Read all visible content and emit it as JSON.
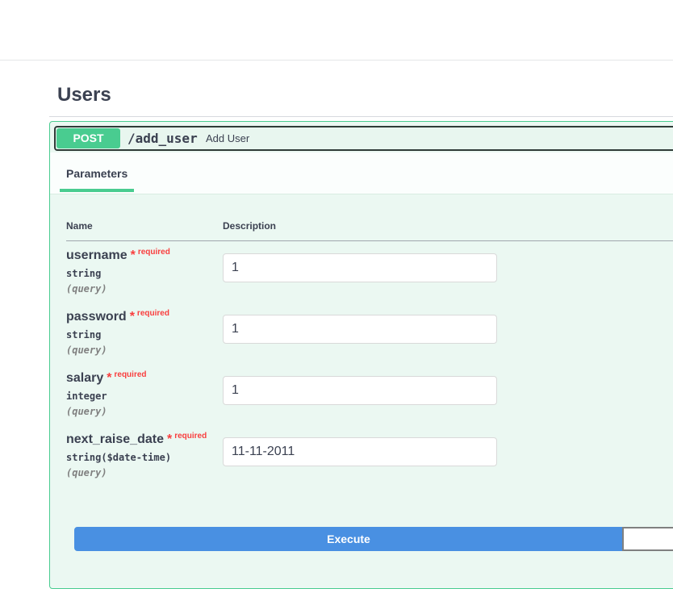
{
  "section": {
    "title": "Users"
  },
  "operation": {
    "method": "POST",
    "path": "/add_user",
    "summary": "Add User"
  },
  "tabs": {
    "parameters": "Parameters"
  },
  "table": {
    "col_name": "Name",
    "col_description": "Description"
  },
  "params": [
    {
      "name": "username",
      "star": "*",
      "required": "required",
      "type": "string",
      "in": "(query)",
      "value": "1"
    },
    {
      "name": "password",
      "star": "*",
      "required": "required",
      "type": "string",
      "in": "(query)",
      "value": "1"
    },
    {
      "name": "salary",
      "star": "*",
      "required": "required",
      "type": "integer",
      "in": "(query)",
      "value": "1"
    },
    {
      "name": "next_raise_date",
      "star": "*",
      "required": "required",
      "type": "string($date-time)",
      "in": "(query)",
      "value": "11-11-2011"
    }
  ],
  "actions": {
    "execute": "Execute"
  },
  "colors": {
    "post_green": "#49cc90",
    "execute_blue": "#4990e2",
    "required_red": "#f93e3e"
  }
}
